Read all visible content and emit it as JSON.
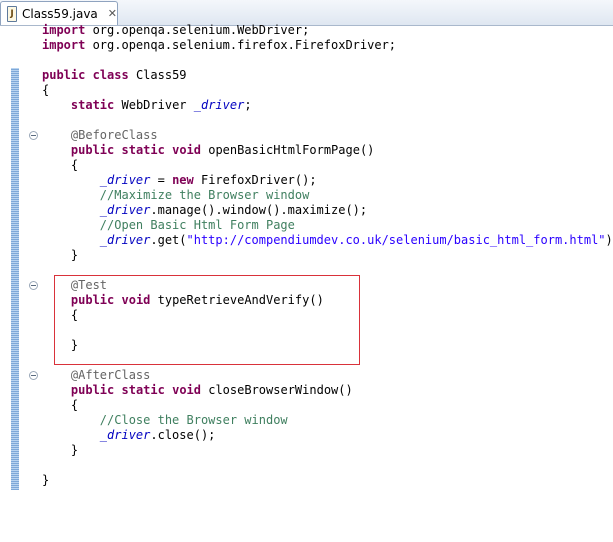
{
  "tab": {
    "icon_letter": "J",
    "title": "Class59.java",
    "close_glyph": "✕"
  },
  "code": {
    "l1": {
      "kw": "import",
      "rest": " org.openqa.selenium.WebDriver;"
    },
    "l2": {
      "kw": "import",
      "rest": " org.openqa.selenium.firefox.FirefoxDriver;"
    },
    "l4": {
      "kw1": "public",
      "kw2": "class",
      "rest": " Class59"
    },
    "l5": {
      "text": "{"
    },
    "l6": {
      "kw": "static",
      "type": " WebDriver ",
      "field": "_driver",
      "end": ";"
    },
    "l8": {
      "ann": "@BeforeClass"
    },
    "l9": {
      "kw1": "public",
      "kw2": "static",
      "kw3": "void",
      "rest": " openBasicHtmlFormPage()"
    },
    "l10": {
      "text": "{"
    },
    "l11": {
      "field": "_driver",
      "mid": " = ",
      "kw": "new",
      "rest": " FirefoxDriver();"
    },
    "l12": {
      "comment": "//Maximize the Browser window"
    },
    "l13": {
      "field": "_driver",
      "rest": ".manage().window().maximize();"
    },
    "l14": {
      "comment": "//Open Basic Html Form Page"
    },
    "l15": {
      "field": "_driver",
      "pre": ".get(",
      "str": "\"http://compendiumdev.co.uk/selenium/basic_html_form.html\"",
      "end": ");"
    },
    "l16": {
      "text": "}"
    },
    "l18": {
      "ann": "@Test"
    },
    "l19": {
      "kw1": "public",
      "kw2": "void",
      "rest": " typeRetrieveAndVerify()"
    },
    "l20": {
      "text": "{"
    },
    "l22": {
      "text": "}"
    },
    "l24": {
      "ann": "@AfterClass"
    },
    "l25": {
      "kw1": "public",
      "kw2": "static",
      "kw3": "void",
      "rest": " closeBrowserWindow()"
    },
    "l26": {
      "text": "{"
    },
    "l27": {
      "comment": "//Close the Browser window"
    },
    "l28": {
      "field": "_driver",
      "rest": ".close();"
    },
    "l29": {
      "text": "}"
    },
    "l31": {
      "text": "}"
    }
  },
  "colors": {
    "keyword": "#7f0055",
    "annotation": "#646464",
    "field": "#0000c0",
    "comment": "#3f7f5f",
    "string": "#2a00ff",
    "highlight_border": "#d9323a"
  }
}
